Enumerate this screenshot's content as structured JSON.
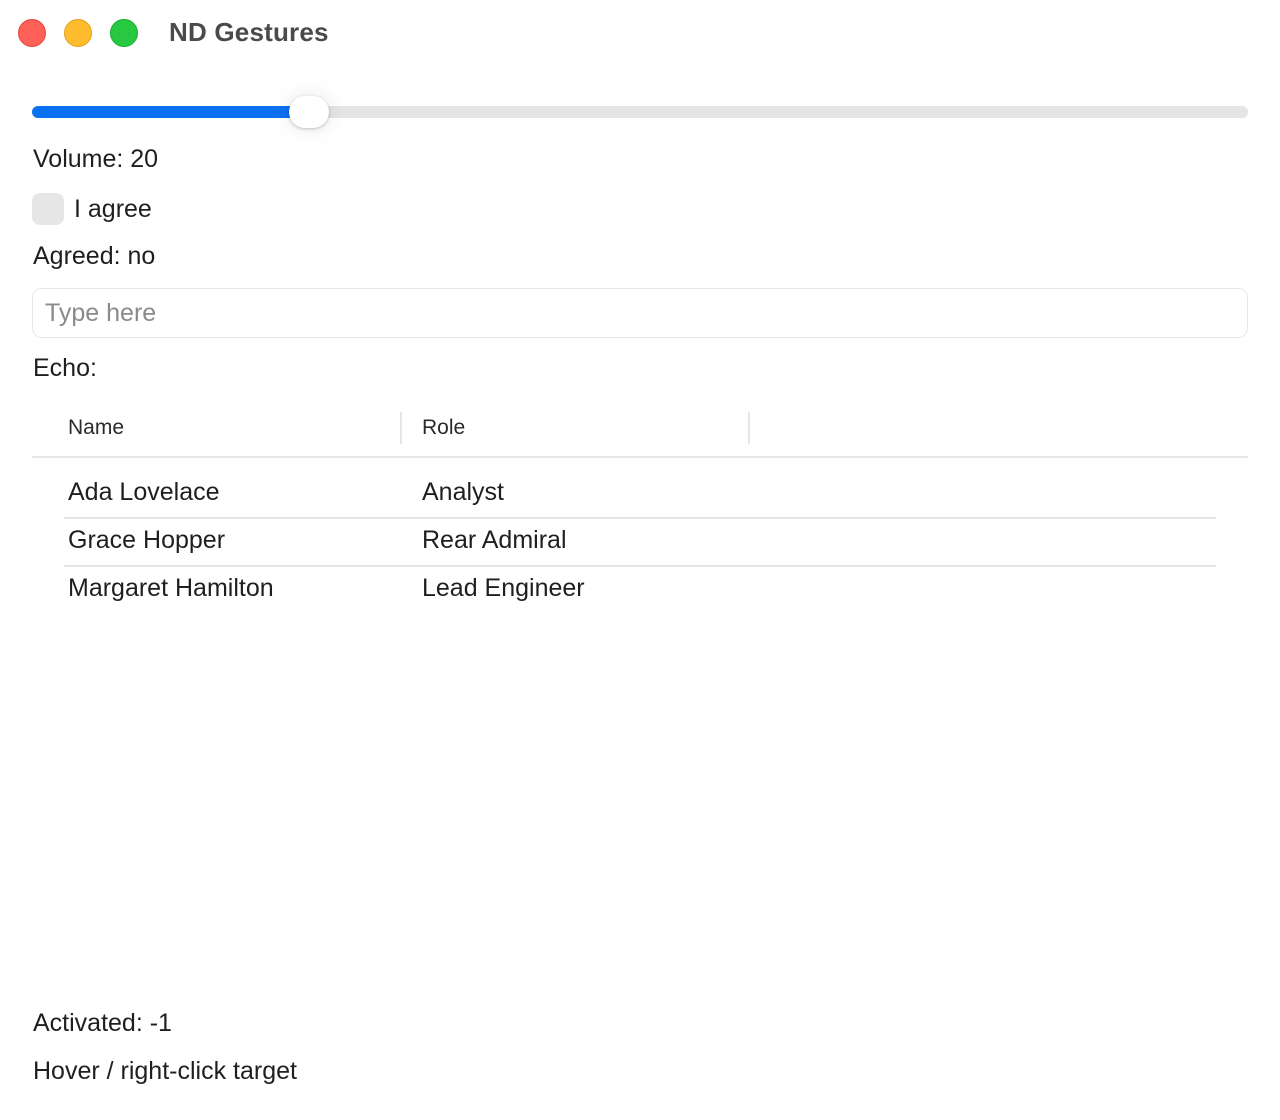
{
  "window": {
    "title": "ND Gestures"
  },
  "slider": {
    "value": 20,
    "min": 0,
    "max": 100,
    "fill_color": "#0a72f0"
  },
  "volume_label": "Volume: 20",
  "checkbox": {
    "label": "I agree",
    "checked": false
  },
  "agreed_label": "Agreed: no",
  "text_field": {
    "value": "",
    "placeholder": "Type here"
  },
  "echo_label": "Echo:",
  "table": {
    "columns": [
      "Name",
      "Role"
    ],
    "rows": [
      {
        "name": "Ada Lovelace",
        "role": "Analyst"
      },
      {
        "name": "Grace Hopper",
        "role": "Rear Admiral"
      },
      {
        "name": "Margaret Hamilton",
        "role": "Lead Engineer"
      }
    ]
  },
  "activated_label": "Activated: -1",
  "hover_target_label": "Hover / right-click target",
  "colors": {
    "close": "#fe5f57",
    "minimize": "#febc2e",
    "zoom": "#28c840"
  }
}
